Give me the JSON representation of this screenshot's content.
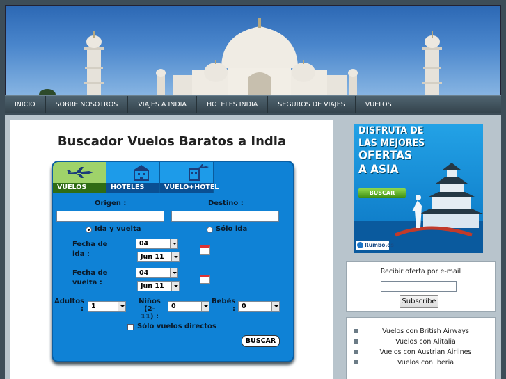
{
  "nav": {
    "items": [
      "INICIO",
      "SOBRE NOSOTROS",
      "VIAJES A INDIA",
      "HOTELES INDIA",
      "SEGUROS DE VIAJES",
      "VUELOS"
    ]
  },
  "main": {
    "title": "Buscador Vuelos Baratos a India"
  },
  "search": {
    "tabs": [
      "VUELOS",
      "HOTELES",
      "VUELO+HOTEL"
    ],
    "origen_label": "Origen :",
    "destino_label": "Destino :",
    "origen_value": "",
    "destino_value": "",
    "round_trip_label": "Ida y vuelta",
    "one_way_label": "Sólo ida",
    "fecha_ida_label_1": "Fecha de",
    "fecha_ida_label_2": "ida :",
    "fecha_vuelta_label_1": "Fecha de",
    "fecha_vuelta_label_2": "vuelta :",
    "ida_day": "04",
    "ida_month": "Jun 11",
    "vuelta_day": "04",
    "vuelta_month": "Jun 11",
    "adultos_label_1": "Adultos",
    "adultos_label_2": ":",
    "adultos_value": "1",
    "ninos_label_1": "Niños (2-",
    "ninos_label_2": "11) :",
    "ninos_value": "0",
    "bebes_label_1": "Bebés",
    "bebes_label_2": ":",
    "bebes_value": "0",
    "direct_label": "Sólo vuelos directos",
    "search_button": "BUSCAR"
  },
  "ad": {
    "line1": "DISFRUTA DE",
    "line2": "LAS MEJORES",
    "line3": "OFERTAS",
    "line4": "A ASIA",
    "button": "BUSCAR",
    "logo": "Rumbo.es"
  },
  "newsletter": {
    "label": "Recibir oferta por e-mail",
    "email_value": "",
    "button": "Subscribe"
  },
  "links": [
    "Vuelos con British Airways",
    "Vuelos con Alitalia",
    "Vuelos con Austrian Airlines",
    "Vuelos con Iberia"
  ],
  "colors": {
    "widget_blue": "#0f82d6",
    "nav_bg": "#3d4d58",
    "active_tab_green": "#2f6c14"
  }
}
